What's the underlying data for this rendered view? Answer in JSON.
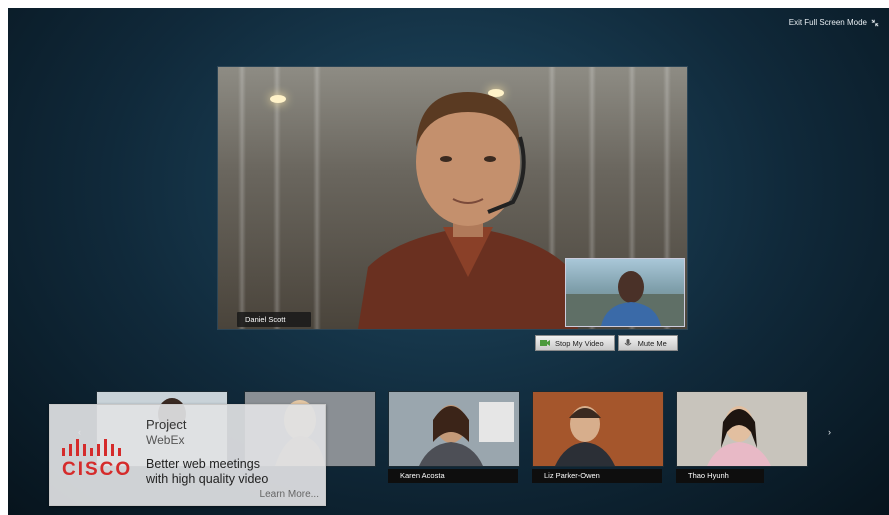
{
  "header": {
    "exit_fullscreen_label": "Exit Full Screen Mode",
    "exit_icon": "collapse-icon"
  },
  "main_video": {
    "speaker_name": "Daniel Scott"
  },
  "controls": {
    "stop_video_label": "Stop My Video",
    "mute_label": "Mute Me",
    "video_icon": "camera-icon",
    "mic_icon": "microphone-icon"
  },
  "thumbnails": [
    {
      "name": ""
    },
    {
      "name": ""
    },
    {
      "name": "Karen Acosta"
    },
    {
      "name": "Liz Parker-Owen"
    },
    {
      "name": "Thao Hyunh"
    }
  ],
  "nav": {
    "prev_icon": "chevron-left-icon",
    "next_icon": "chevron-right-icon"
  },
  "overlay": {
    "logo_text": "CISCO",
    "title": "Project",
    "subtitle": "WebEx",
    "tagline_1": "Better web meetings",
    "tagline_2": "with high quality video",
    "link": "Learn More..."
  },
  "colors": {
    "accent_red": "#d52b2b",
    "stage_bg": "#10293a"
  }
}
